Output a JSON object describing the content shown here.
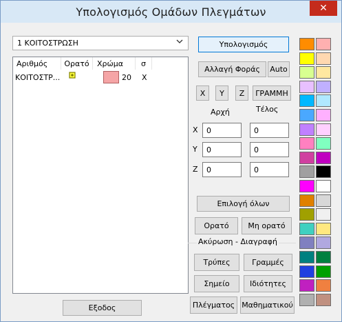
{
  "window": {
    "title": "Υπολογισμός Ομάδων Πλεγμάτων",
    "close_glyph": "✕"
  },
  "group_select": {
    "value": "1 ΚΟΙΤΟΣΤΡΩΣΗ"
  },
  "table": {
    "columns": [
      "Αριθμός",
      "Ορατό",
      "Χρώμα",
      "σ"
    ],
    "rows": [
      {
        "name": "ΚΟΙΤΟΣΤΡ...",
        "visible_icon": "sun-icon",
        "color": "#f5a5a6",
        "color_value": "20",
        "sigma": "X"
      }
    ]
  },
  "buttons": {
    "calculate": "Υπολογισμός",
    "change_direction": "Αλλαγή Φοράς",
    "auto": "Auto",
    "x": "X",
    "y": "Y",
    "z": "Z",
    "line": "ΓΡΑΜΜΗ",
    "select_all": "Επιλογή όλων",
    "visible": "Ορατό",
    "invisible": "Μη ορατό",
    "holes": "Τρύπες",
    "lines": "Γραμμές",
    "point": "Σημείο",
    "properties": "Ιδιότητες",
    "mesh": "Πλέγματος",
    "mathematical": "Μαθηματικού",
    "exit": "Εξοδος"
  },
  "coords": {
    "start_label": "Αρχή",
    "end_label": "Τέλος",
    "rows": [
      {
        "axis": "X",
        "start": "0",
        "end": "0"
      },
      {
        "axis": "Y",
        "start": "0",
        "end": "0"
      },
      {
        "axis": "Z",
        "start": "0",
        "end": "0"
      }
    ]
  },
  "delete_group": {
    "label": "Ακύρωση - Διαγραφή"
  },
  "palette": [
    [
      "#ff8c00",
      "#ffb0b0"
    ],
    [
      "#ffff00",
      "#ffd8b0"
    ],
    [
      "#d8ff90",
      "#ffe8a0"
    ],
    [
      "#e8c0ff",
      "#c0b0ff"
    ],
    [
      "#00b8ff",
      "#b0e8ff"
    ],
    [
      "#4aa8ff",
      "#ffb0ff"
    ],
    [
      "#c080ff",
      "#ffd0ff"
    ],
    [
      "#ff80c0",
      "#80ffc0"
    ],
    [
      "#d040a0",
      "#c000c0"
    ],
    [
      "#a0a0a0",
      "#000000"
    ],
    [
      "#ff00ff",
      "#ffffff"
    ],
    [
      "#e08000",
      "#d8d8d8"
    ],
    [
      "#a0a000",
      "#f0f0f0"
    ],
    [
      "#40d0c0",
      "#ffe880"
    ],
    [
      "#8080c0",
      "#b0a8e0"
    ],
    [
      "#008080",
      "#008040"
    ],
    [
      "#2040e0",
      "#00a000"
    ],
    [
      "#c020c0",
      "#f08040"
    ],
    [
      "#b0b0b0",
      "#c09080"
    ]
  ]
}
